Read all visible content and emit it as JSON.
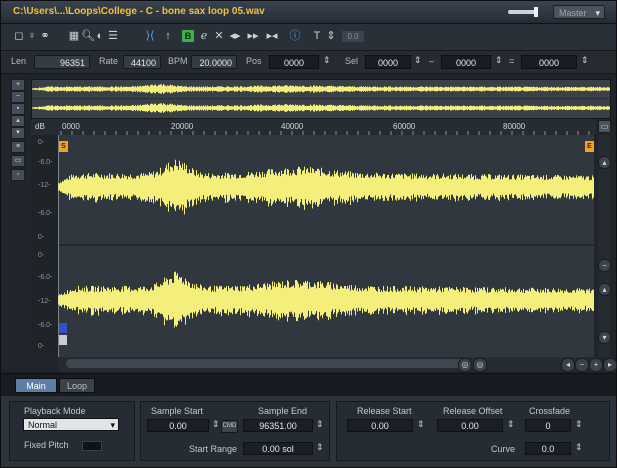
{
  "window": {
    "title": "C:\\Users\\...\\Loops\\College - C - bone sax loop 05.wav",
    "master_label": "Master",
    "accent_color": "#f0c23a"
  },
  "toolbar": {
    "icons": [
      "new-icon",
      "marker-icon",
      "link-icon",
      "select-icon",
      "zoom-icon",
      "draw-icon",
      "list-icon",
      "loop-icon",
      "play-icon",
      "green-b-icon",
      "edit-icon",
      "cut-icon",
      "prev-icon",
      "play-region-icon",
      "next-icon",
      "info-icon",
      "text-icon",
      "spin-icon"
    ],
    "green_label": "B",
    "small_field": "0.0"
  },
  "params": {
    "len_label": "Len",
    "len_value": "96351",
    "rate_label": "Rate",
    "rate_value": "44100",
    "bpm_label": "BPM",
    "bpm_value": "20.0000",
    "pos_label": "Pos",
    "pos_value": "0000",
    "sel_label": "Sel",
    "sel_start": "0000",
    "sel_dash": "–",
    "sel_end": "0000",
    "sel_eq": "=",
    "sel_len": "0000"
  },
  "ruler": {
    "db_label": "dB",
    "ticks": [
      "0000",
      "20000",
      "40000",
      "60000",
      "80000"
    ]
  },
  "scale": {
    "top": [
      "0-",
      "-6.0-",
      "-12-",
      "-6.0-",
      "0-"
    ],
    "bottom": [
      "0-",
      "-6.0-",
      "-12-",
      "-6.0-",
      "0-"
    ]
  },
  "markers": {
    "start": "S",
    "end": "E"
  },
  "waveform": {
    "color": "#f4ef7a",
    "background": "#31373f"
  },
  "tabs": [
    {
      "label": "Main",
      "active": true
    },
    {
      "label": "Loop",
      "active": false
    }
  ],
  "bottom": {
    "playback_mode_label": "Playback Mode",
    "playback_mode_value": "Normal",
    "fixed_pitch_label": "Fixed Pitch",
    "sample_start_label": "Sample Start",
    "sample_start_value": "0.00",
    "cmd_label": "CMD",
    "sample_end_label": "Sample End",
    "sample_end_value": "96351.00",
    "start_range_label": "Start Range",
    "start_range_value": "0.00 sol",
    "release_start_label": "Release Start",
    "release_start_value": "0.00",
    "release_offset_label": "Release Offset",
    "release_offset_value": "0.00",
    "crossfade_label": "Crossfade",
    "crossfade_value": "0",
    "curve_label": "Curve",
    "curve_value": "0.0"
  }
}
